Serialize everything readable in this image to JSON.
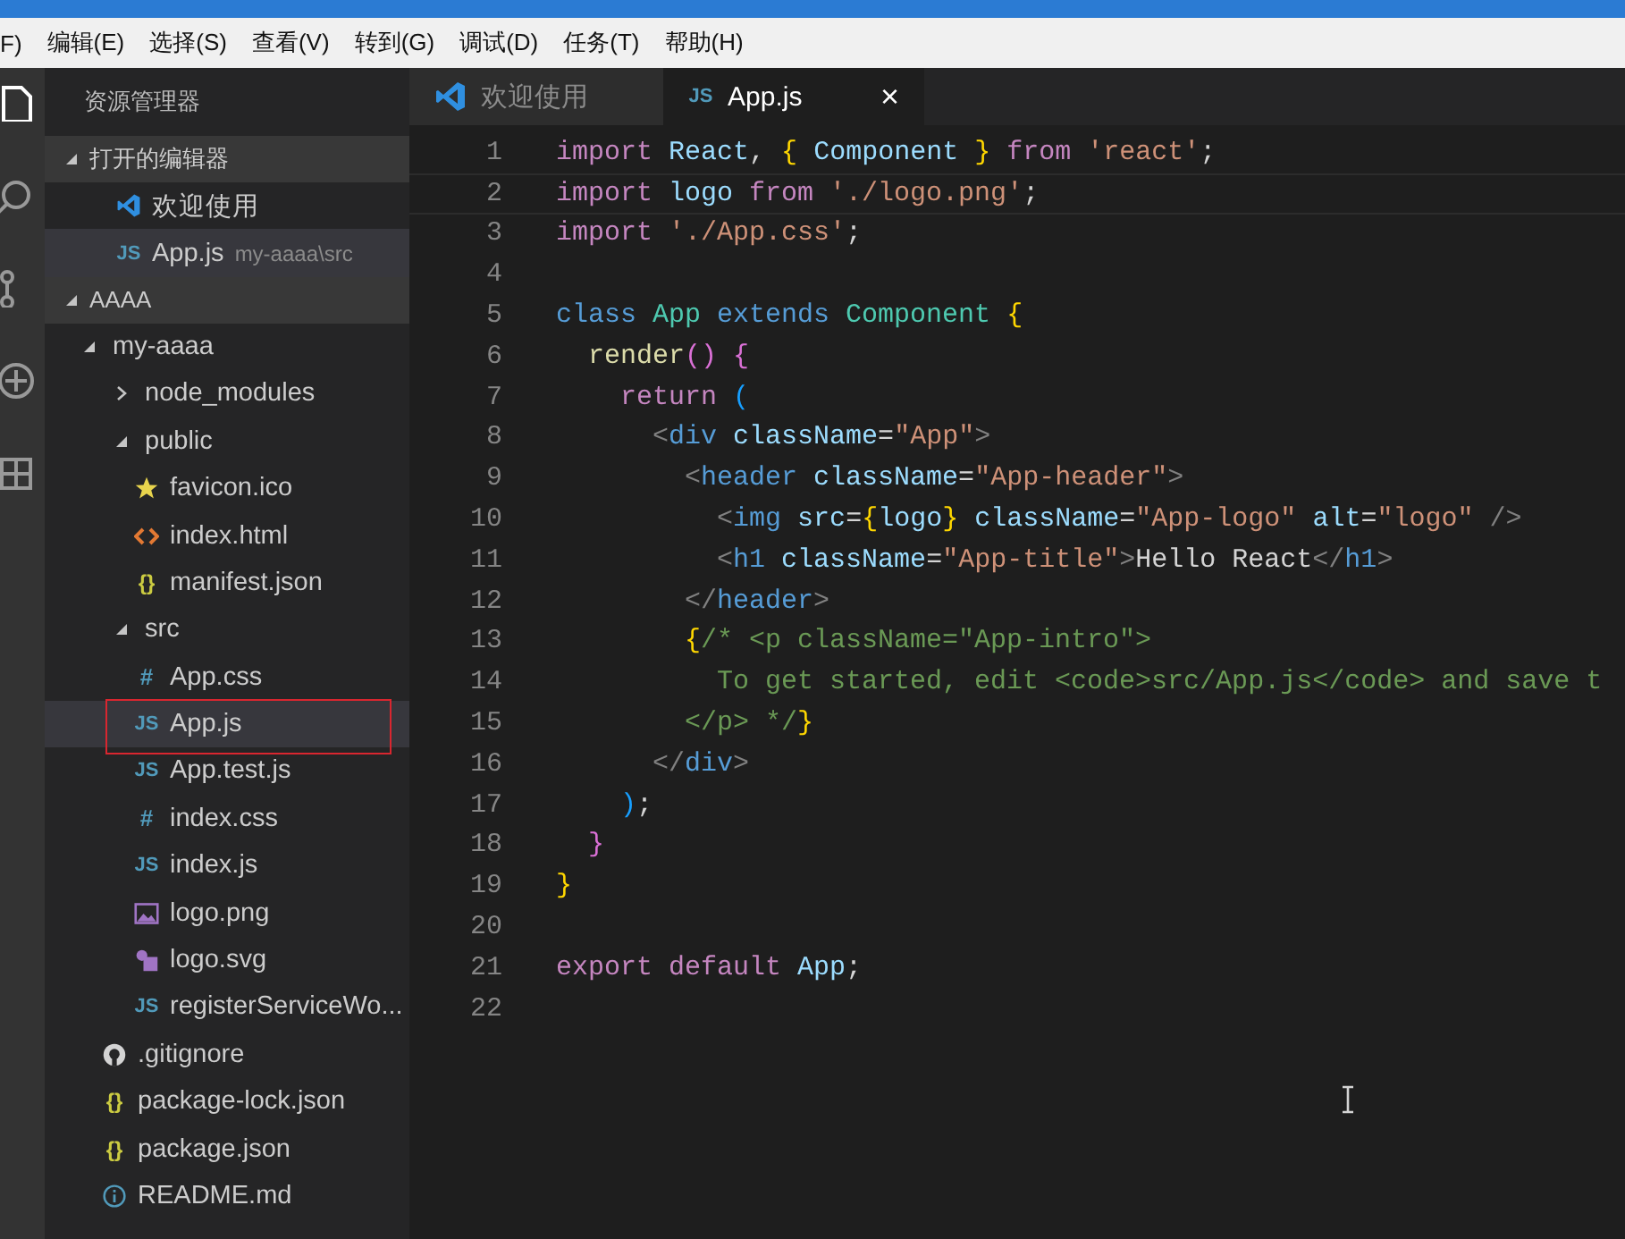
{
  "menu": [
    "F)",
    "编辑(E)",
    "选择(S)",
    "查看(V)",
    "转到(G)",
    "调试(D)",
    "任务(T)",
    "帮助(H)"
  ],
  "sidebar": {
    "title": "资源管理器",
    "open_editors": {
      "title": "打开的编辑器",
      "expanded": true,
      "items": [
        {
          "name": "欢迎使用",
          "kind": "vscode",
          "selected": false
        },
        {
          "name": "App.js",
          "kind": "js",
          "glyph": "JS",
          "description": "my-aaaa\\src",
          "selected": true
        }
      ]
    },
    "folder": {
      "title": "AAAA",
      "expanded": true,
      "tree": [
        {
          "name": "my-aaaa",
          "kind": "folder",
          "expanded": true,
          "selected": false,
          "children": [
            {
              "name": "node_modules",
              "kind": "folder",
              "expanded": false,
              "selected": false
            },
            {
              "name": "public",
              "kind": "folder",
              "expanded": true,
              "selected": false,
              "children": [
                {
                  "name": "favicon.ico",
                  "kind": "star",
                  "selected": false
                },
                {
                  "name": "index.html",
                  "kind": "html",
                  "selected": false
                },
                {
                  "name": "manifest.json",
                  "kind": "json",
                  "glyph": "{}",
                  "selected": false
                }
              ]
            },
            {
              "name": "src",
              "kind": "folder",
              "expanded": true,
              "selected": false,
              "children": [
                {
                  "name": "App.css",
                  "kind": "css",
                  "glyph": "#",
                  "selected": false
                },
                {
                  "name": "App.js",
                  "kind": "js",
                  "glyph": "JS",
                  "selected": true,
                  "marked": true
                },
                {
                  "name": "App.test.js",
                  "kind": "js",
                  "glyph": "JS",
                  "selected": false
                },
                {
                  "name": "index.css",
                  "kind": "css",
                  "glyph": "#",
                  "selected": false
                },
                {
                  "name": "index.js",
                  "kind": "js",
                  "glyph": "JS",
                  "selected": false
                },
                {
                  "name": "logo.png",
                  "kind": "image",
                  "selected": false
                },
                {
                  "name": "logo.svg",
                  "kind": "svg",
                  "selected": false
                },
                {
                  "name": "registerServiceWo...",
                  "kind": "js",
                  "glyph": "JS",
                  "selected": false
                }
              ]
            },
            {
              "name": ".gitignore",
              "kind": "git",
              "selected": false
            },
            {
              "name": "package-lock.json",
              "kind": "json",
              "glyph": "{}",
              "selected": false
            },
            {
              "name": "package.json",
              "kind": "json",
              "glyph": "{}",
              "selected": false
            },
            {
              "name": "README.md",
              "kind": "info",
              "selected": false
            }
          ]
        }
      ]
    }
  },
  "tabs": [
    {
      "label": "欢迎使用",
      "kind": "vscode",
      "selected": false
    },
    {
      "label": "App.js",
      "kind": "js",
      "glyph": "JS",
      "selected": true,
      "close": "×"
    }
  ],
  "editor": {
    "lines": [
      {
        "number": "1",
        "tokens": [
          {
            "kind": "kw",
            "text": "import "
          },
          {
            "kind": "var",
            "text": "React"
          },
          {
            "kind": "pl",
            "text": ", "
          },
          {
            "kind": "br",
            "text": "{ "
          },
          {
            "kind": "var",
            "text": "Component "
          },
          {
            "kind": "br",
            "text": "} "
          },
          {
            "kind": "kw",
            "text": "from "
          },
          {
            "kind": "str",
            "text": "'react'"
          },
          {
            "kind": "pl",
            "text": ";"
          }
        ]
      },
      {
        "number": "2",
        "current": true,
        "tokens": [
          {
            "kind": "kw",
            "text": "import "
          },
          {
            "kind": "var",
            "text": "logo "
          },
          {
            "kind": "kw",
            "text": "from "
          },
          {
            "kind": "str",
            "text": "'./logo.png'"
          },
          {
            "kind": "pl",
            "text": ";"
          }
        ]
      },
      {
        "number": "3",
        "tokens": [
          {
            "kind": "kw",
            "text": "import "
          },
          {
            "kind": "str",
            "text": "'./App.css'"
          },
          {
            "kind": "pl",
            "text": ";"
          }
        ]
      },
      {
        "number": "4"
      },
      {
        "number": "5",
        "tokens": [
          {
            "kind": "st",
            "text": "class "
          },
          {
            "kind": "cls",
            "text": "App "
          },
          {
            "kind": "st",
            "text": "extends "
          },
          {
            "kind": "cls",
            "text": "Component "
          },
          {
            "kind": "br",
            "text": "{"
          }
        ]
      },
      {
        "number": "6",
        "tokens": [
          {
            "kind": "fn",
            "text": "  render"
          },
          {
            "kind": "p2",
            "text": "() {"
          }
        ]
      },
      {
        "number": "7",
        "tokens": [
          {
            "kind": "kw",
            "text": "    return "
          },
          {
            "kind": "p3",
            "text": "("
          }
        ]
      },
      {
        "number": "8",
        "tokens": [
          {
            "kind": "ang",
            "text": "      <"
          },
          {
            "kind": "tag",
            "text": "div "
          },
          {
            "kind": "attr",
            "text": "className"
          },
          {
            "kind": "pl",
            "text": "="
          },
          {
            "kind": "str",
            "text": "\"App\""
          },
          {
            "kind": "ang",
            "text": ">"
          }
        ]
      },
      {
        "number": "9",
        "tokens": [
          {
            "kind": "ang",
            "text": "        <"
          },
          {
            "kind": "tag",
            "text": "header "
          },
          {
            "kind": "attr",
            "text": "className"
          },
          {
            "kind": "pl",
            "text": "="
          },
          {
            "kind": "str",
            "text": "\"App-header\""
          },
          {
            "kind": "ang",
            "text": ">"
          }
        ]
      },
      {
        "number": "10",
        "tokens": [
          {
            "kind": "ang",
            "text": "          <"
          },
          {
            "kind": "tag",
            "text": "img "
          },
          {
            "kind": "attr",
            "text": "src"
          },
          {
            "kind": "pl",
            "text": "="
          },
          {
            "kind": "br",
            "text": "{"
          },
          {
            "kind": "var",
            "text": "logo"
          },
          {
            "kind": "br",
            "text": "}"
          },
          {
            "kind": "attr",
            "text": " className"
          },
          {
            "kind": "pl",
            "text": "="
          },
          {
            "kind": "str",
            "text": "\"App-logo\" "
          },
          {
            "kind": "attr",
            "text": "alt"
          },
          {
            "kind": "pl",
            "text": "="
          },
          {
            "kind": "str",
            "text": "\"logo\" "
          },
          {
            "kind": "ang",
            "text": "/>"
          }
        ]
      },
      {
        "number": "11",
        "tokens": [
          {
            "kind": "ang",
            "text": "          <"
          },
          {
            "kind": "tag",
            "text": "h1 "
          },
          {
            "kind": "attr",
            "text": "className"
          },
          {
            "kind": "pl",
            "text": "="
          },
          {
            "kind": "str",
            "text": "\"App-title\""
          },
          {
            "kind": "ang",
            "text": ">"
          },
          {
            "kind": "pl",
            "text": "Hello React"
          },
          {
            "kind": "ang",
            "text": "</"
          },
          {
            "kind": "tag",
            "text": "h1"
          },
          {
            "kind": "ang",
            "text": ">"
          }
        ]
      },
      {
        "number": "12",
        "tokens": [
          {
            "kind": "ang",
            "text": "        </"
          },
          {
            "kind": "tag",
            "text": "header"
          },
          {
            "kind": "ang",
            "text": ">"
          }
        ]
      },
      {
        "number": "13",
        "tokens": [
          {
            "kind": "br",
            "text": "        {"
          },
          {
            "kind": "cm",
            "text": "/* <p className=\"App-intro\">"
          }
        ]
      },
      {
        "number": "14",
        "tokens": [
          {
            "kind": "cm",
            "text": "          To get started, edit <code>src/App.js</code> and save t"
          }
        ]
      },
      {
        "number": "15",
        "tokens": [
          {
            "kind": "cm",
            "text": "        </p> */"
          },
          {
            "kind": "br",
            "text": "}"
          }
        ]
      },
      {
        "number": "16",
        "tokens": [
          {
            "kind": "ang",
            "text": "      </"
          },
          {
            "kind": "tag",
            "text": "div"
          },
          {
            "kind": "ang",
            "text": ">"
          }
        ]
      },
      {
        "number": "17",
        "tokens": [
          {
            "kind": "p3",
            "text": "    )"
          },
          {
            "kind": "pl",
            "text": ";"
          }
        ]
      },
      {
        "number": "18",
        "tokens": [
          {
            "kind": "p2",
            "text": "  }"
          }
        ]
      },
      {
        "number": "19",
        "tokens": [
          {
            "kind": "br",
            "text": "}"
          }
        ]
      },
      {
        "number": "20"
      },
      {
        "number": "21",
        "tokens": [
          {
            "kind": "kw",
            "text": "export default "
          },
          {
            "kind": "var",
            "text": "App"
          },
          {
            "kind": "pl",
            "text": ";"
          }
        ]
      },
      {
        "number": "22"
      }
    ]
  }
}
